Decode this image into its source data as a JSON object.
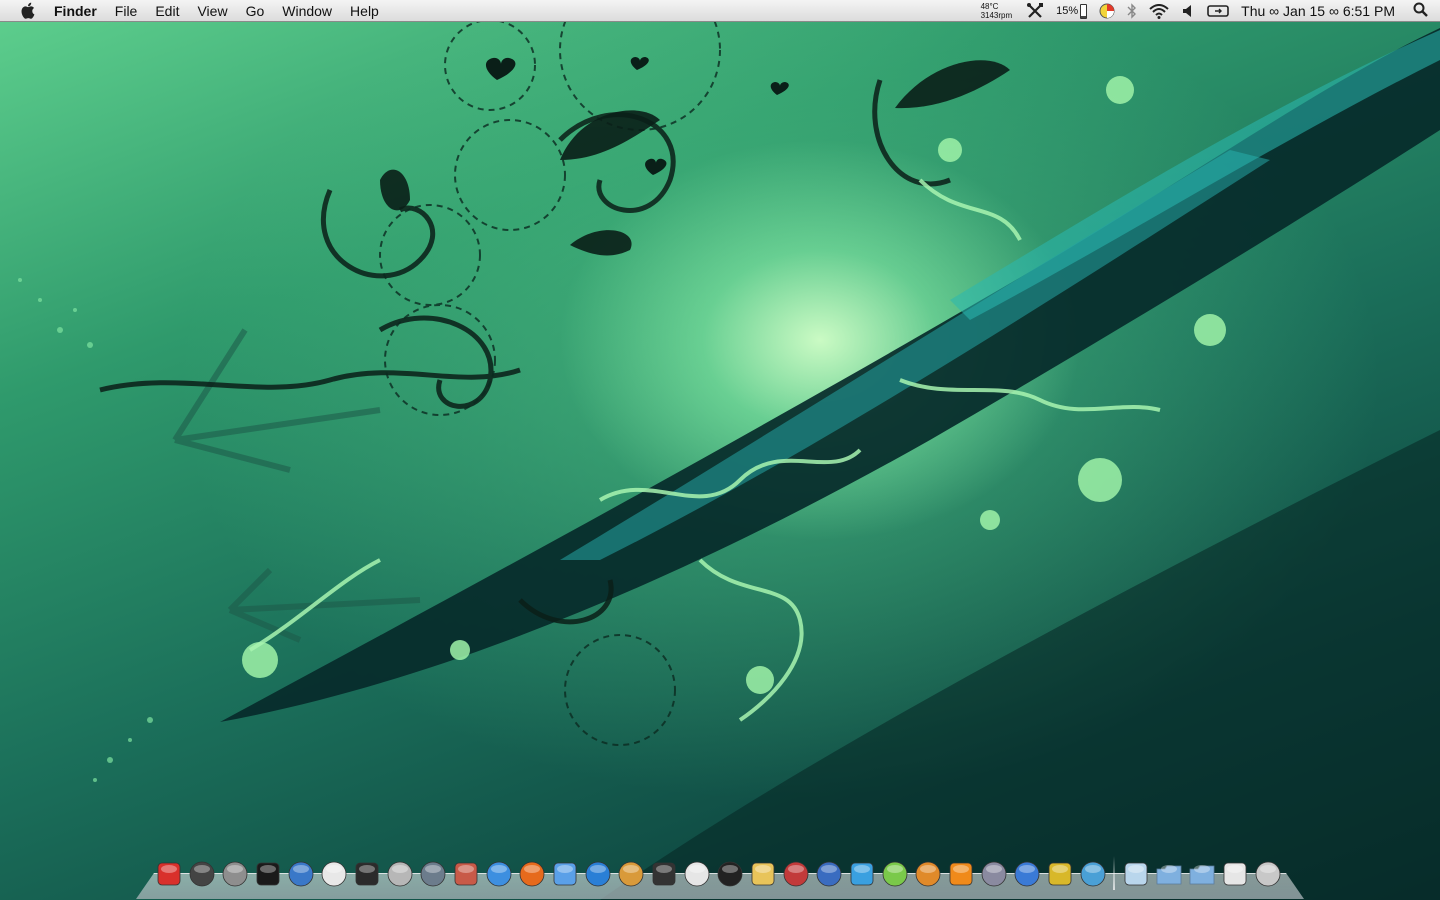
{
  "menubar": {
    "app_name": "Finder",
    "items": [
      "File",
      "Edit",
      "View",
      "Go",
      "Window",
      "Help"
    ],
    "status": {
      "temperature": "48°C",
      "fan_speed": "3143rpm",
      "battery_percent": "15%",
      "battery_level": 0.15,
      "clock": "Thu ∞ Jan 15 ∞ 6:51 PM"
    },
    "icons": [
      "apple-icon",
      "tools-icon",
      "battery-icon",
      "pie-chart-icon",
      "bluetooth-icon",
      "wifi-icon",
      "volume-icon",
      "display-icon",
      "spotlight-icon"
    ]
  },
  "dock": {
    "apps": [
      {
        "name": "finder-icon",
        "color": "#d9302b"
      },
      {
        "name": "dashboard-icon",
        "color": "#444444"
      },
      {
        "name": "system-preferences-icon",
        "color": "#8e8e8e"
      },
      {
        "name": "terminal-icon",
        "color": "#1a1a1a"
      },
      {
        "name": "network-icon",
        "color": "#3a78c8"
      },
      {
        "name": "airport-icon",
        "color": "#e8e8e8"
      },
      {
        "name": "activity-monitor-icon",
        "color": "#2b2b2b"
      },
      {
        "name": "disk-utility-icon",
        "color": "#b7b7b7"
      },
      {
        "name": "utility-icon",
        "color": "#6c7c8c"
      },
      {
        "name": "photo-booth-icon",
        "color": "#c85a48"
      },
      {
        "name": "safari-icon",
        "color": "#3d8fe0"
      },
      {
        "name": "firefox-icon",
        "color": "#e66a1c"
      },
      {
        "name": "itunes-icon",
        "color": "#5aa0e8"
      },
      {
        "name": "quicktime-icon",
        "color": "#2a7fd6"
      },
      {
        "name": "iphoto-icon",
        "color": "#d99a3a"
      },
      {
        "name": "camera-icon",
        "color": "#333333"
      },
      {
        "name": "calendar-icon",
        "color": "#e6e6e6"
      },
      {
        "name": "ipod-icon",
        "color": "#222222"
      },
      {
        "name": "mail-icon",
        "color": "#e8c45a"
      },
      {
        "name": "vmware-icon",
        "color": "#c23a3a"
      },
      {
        "name": "windows-icon",
        "color": "#3a6cc0"
      },
      {
        "name": "chart-app-icon",
        "color": "#3aa0e0"
      },
      {
        "name": "plant-app-icon",
        "color": "#7ac94a"
      },
      {
        "name": "keynote-icon",
        "color": "#e08a2a"
      },
      {
        "name": "pages-icon",
        "color": "#f08a1a"
      },
      {
        "name": "script-editor-icon",
        "color": "#8a8aa0"
      },
      {
        "name": "word-icon",
        "color": "#3a7ad6"
      },
      {
        "name": "game-icon",
        "color": "#d8b82a"
      },
      {
        "name": "xcode-icon",
        "color": "#4aa0d6"
      }
    ],
    "stacks": [
      {
        "name": "documents-stack-icon",
        "color": "#b9d6ec"
      },
      {
        "name": "applications-folder-icon",
        "color": "#7fb0df"
      },
      {
        "name": "downloads-folder-icon",
        "color": "#7fb0df"
      },
      {
        "name": "pictures-stack-icon",
        "color": "#e6e6e6"
      },
      {
        "name": "trash-icon",
        "color": "#c8c8c8"
      }
    ]
  }
}
